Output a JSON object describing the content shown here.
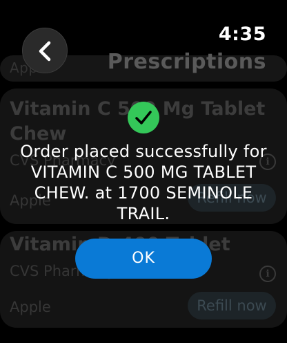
{
  "status_bar": {
    "time": "4:35"
  },
  "header": {
    "title": "Prescriptions",
    "back_icon": "chevron-left-icon"
  },
  "prescriptions": [
    {
      "title": "Vitamin C 500 Mg Tablet Chew",
      "pharmacy": "CVS Pharmacy",
      "location": "Apple",
      "action_label": "Refill now",
      "info_icon": "info-icon"
    },
    {
      "title": "Vitamin D-400 Tablet",
      "pharmacy": "CVS Pharmacy",
      "location": "Apple",
      "action_label": "Refill now",
      "info_icon": "info-icon"
    }
  ],
  "dialog": {
    "icon": "checkmark-circle-icon",
    "message": "Order placed successfully for VITAMIN C 500 MG TABLET CHEW. at 1700 SEMINOLE TRAIL.",
    "ok_label": "OK"
  },
  "colors": {
    "accent_blue": "#0a7ad6",
    "success_green": "#34c759",
    "background": "#000000"
  }
}
